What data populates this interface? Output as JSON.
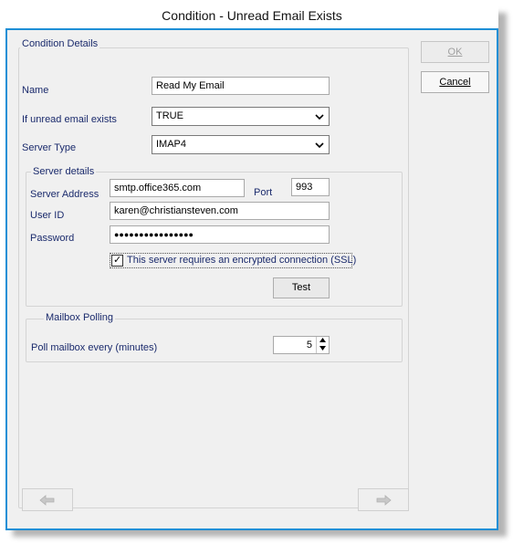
{
  "window": {
    "title": "Condition - Unread Email  Exists"
  },
  "condition_details": {
    "legend": "Condition Details",
    "name_label": "Name",
    "name_value": "Read My Email",
    "unread_label": "If unread email exists",
    "unread_value": "TRUE",
    "server_type_label": "Server Type",
    "server_type_value": "IMAP4"
  },
  "server_details": {
    "legend": "Server details",
    "address_label": "Server Address",
    "address_value": "smtp.office365.com",
    "port_label": "Port",
    "port_value": "993",
    "userid_label": "User ID",
    "userid_value": "karen@christiansteven.com",
    "password_label": "Password",
    "password_value": "●●●●●●●●●●●●●●●●",
    "ssl_label": "This server requires an encrypted connection (SSL)",
    "ssl_checked": "✓",
    "test_label": "Test"
  },
  "mailbox_polling": {
    "legend": "Mailbox Polling",
    "poll_label": "Poll mailbox every (minutes)",
    "poll_value": "5"
  },
  "buttons": {
    "ok_label": "OK",
    "cancel_label": "Cancel"
  },
  "nav": {
    "back_icon": "arrow-left-icon",
    "next_icon": "arrow-right-icon"
  }
}
